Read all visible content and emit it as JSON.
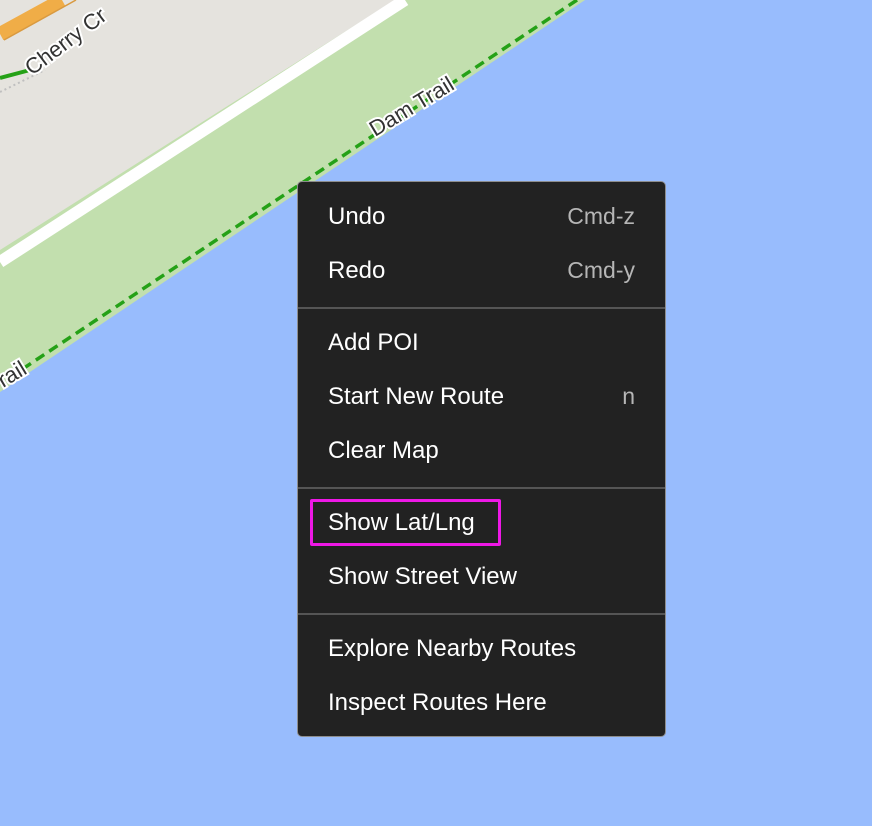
{
  "map": {
    "colors": {
      "water": "#98bcfd",
      "park": "#c2dfae",
      "land": "#e5e3de",
      "trail": "#25a117",
      "road_edge": "#ffffff",
      "road_orange": "#f0ad47"
    },
    "labels": {
      "cherry_street": "Cherry Cr",
      "dam_trail": "Dam Trail",
      "trail_edge": "rail"
    }
  },
  "context_menu": {
    "groups": [
      [
        {
          "label": "Undo",
          "shortcut": "Cmd-z"
        },
        {
          "label": "Redo",
          "shortcut": "Cmd-y"
        }
      ],
      [
        {
          "label": "Add POI",
          "shortcut": ""
        },
        {
          "label": "Start New Route",
          "shortcut": "n"
        },
        {
          "label": "Clear Map",
          "shortcut": ""
        }
      ],
      [
        {
          "label": "Show Lat/Lng",
          "shortcut": ""
        },
        {
          "label": "Show Street View",
          "shortcut": ""
        }
      ],
      [
        {
          "label": "Explore Nearby Routes",
          "shortcut": ""
        },
        {
          "label": "Inspect Routes Here",
          "shortcut": ""
        }
      ]
    ],
    "highlight_color": "#ee18e6"
  }
}
